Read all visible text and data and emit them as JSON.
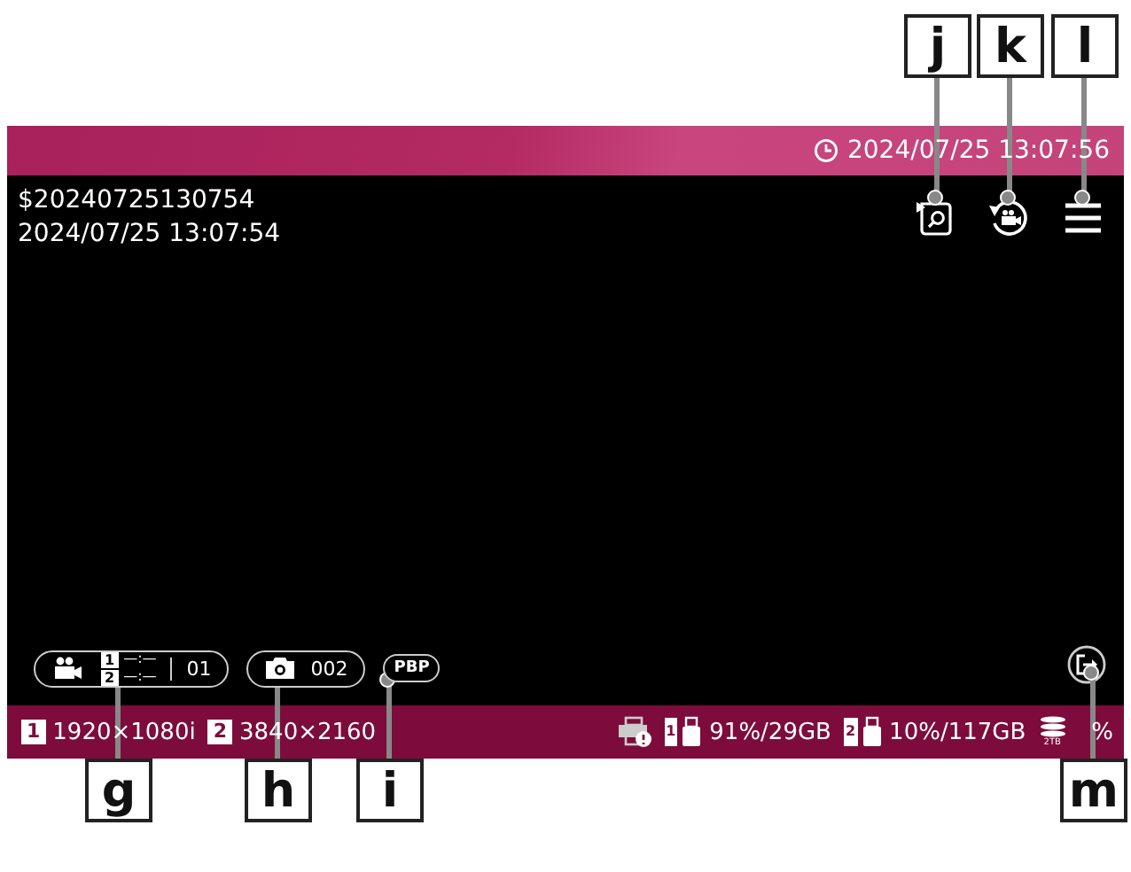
{
  "clock": {
    "time": "2024/07/25 13:07:56"
  },
  "file": {
    "name": "$20240725130754",
    "datetime": "2024/07/25 13:07:54"
  },
  "recording": {
    "slots": [
      {
        "number": "1",
        "time": "—:—"
      },
      {
        "number": "2",
        "time": "—:—"
      }
    ],
    "count": "01"
  },
  "photo": {
    "count": "002"
  },
  "mode_badge": "PBP",
  "status": {
    "inputs": [
      {
        "number": "1",
        "resolution": "1920×1080i"
      },
      {
        "number": "2",
        "resolution": "3840×2160"
      }
    ],
    "storage": [
      {
        "number": "1",
        "usage": "91%/29GB"
      },
      {
        "number": "2",
        "usage": "10%/117GB"
      }
    ],
    "drive_label": "2TB",
    "drive_usage": "%"
  },
  "callouts": [
    {
      "letter": "j"
    },
    {
      "letter": "k"
    },
    {
      "letter": "l"
    },
    {
      "letter": "g"
    },
    {
      "letter": "h"
    },
    {
      "letter": "i"
    },
    {
      "letter": "m"
    }
  ]
}
